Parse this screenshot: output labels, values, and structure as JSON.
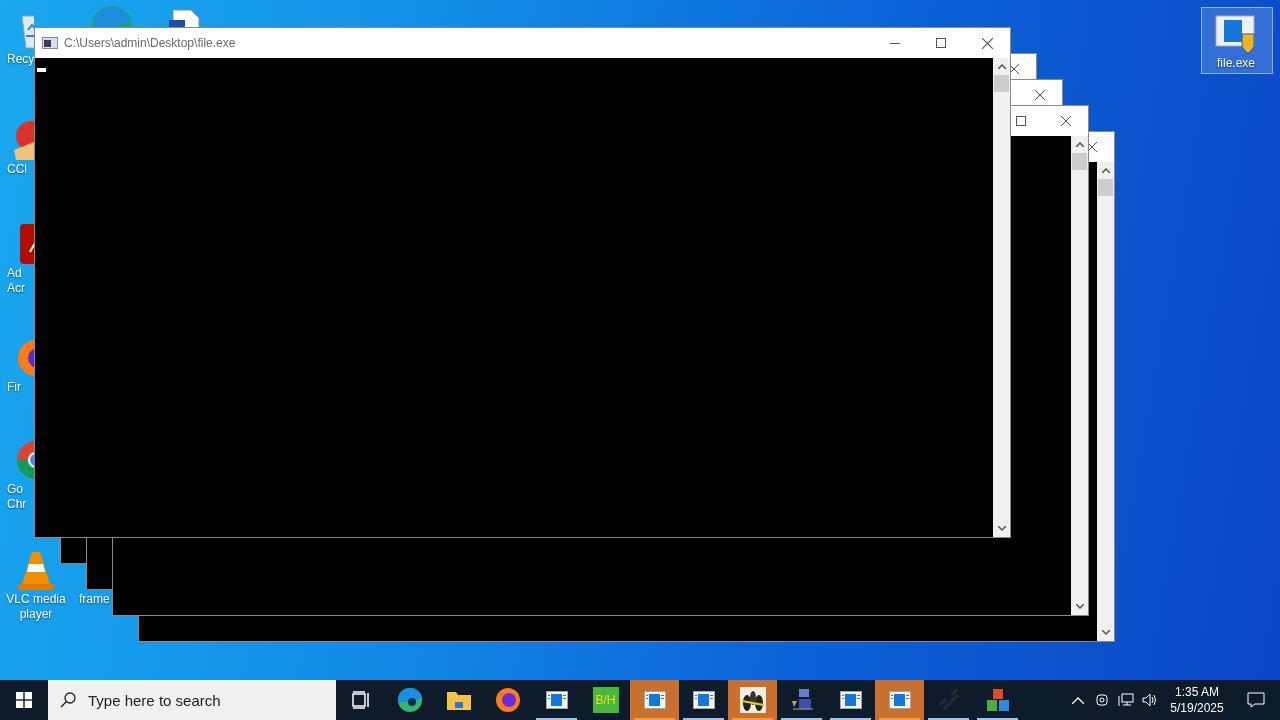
{
  "desktop_icons": [
    {
      "kind": "recycle-bin",
      "lines": [
        "Recy"
      ],
      "selected": false
    },
    {
      "kind": "edge",
      "selected": false
    },
    {
      "kind": "document",
      "selected": false
    },
    {
      "kind": "ccleaner",
      "lines": [
        "CCl"
      ],
      "selected": false
    },
    {
      "kind": "acrobat",
      "lines": [
        "Ad",
        "Acr"
      ],
      "selected": false
    },
    {
      "kind": "firefox",
      "lines": [
        "Fir"
      ],
      "selected": false
    },
    {
      "kind": "chrome",
      "lines": [
        "Go",
        "Chr"
      ],
      "selected": false
    },
    {
      "kind": "vlc",
      "lines": [
        "VLC media",
        "player"
      ],
      "selected": false
    },
    {
      "kind": "frame",
      "lines": [
        "frame"
      ],
      "selected": false
    },
    {
      "kind": "exe",
      "lines": [
        "file.exe"
      ],
      "selected": true
    }
  ],
  "windows": [
    {
      "kind": "console",
      "title": "C:\\Users\\admin\\Desktop\\file.exe",
      "cursor": true
    },
    {
      "kind": "console"
    },
    {
      "kind": "console"
    },
    {
      "kind": "console"
    },
    {
      "kind": "console"
    }
  ],
  "taskbar": {
    "search": {
      "placeholder": "Type here to search"
    },
    "items": [
      {
        "kind": "task-view",
        "running": false,
        "flashing": false
      },
      {
        "kind": "edge",
        "running": false,
        "flashing": false
      },
      {
        "kind": "folder",
        "running": false,
        "flashing": false
      },
      {
        "kind": "firefox",
        "running": false,
        "flashing": false
      },
      {
        "kind": "app-window",
        "running": true,
        "flashing": false
      },
      {
        "kind": "bh",
        "text": "B/H",
        "running": false,
        "flashing": false
      },
      {
        "kind": "app-window",
        "running": true,
        "flashing": true
      },
      {
        "kind": "app-window",
        "running": true,
        "flashing": false
      },
      {
        "kind": "binoculars",
        "running": true,
        "flashing": true
      },
      {
        "kind": "installer",
        "running": true,
        "flashing": false
      },
      {
        "kind": "app-window",
        "running": true,
        "flashing": false
      },
      {
        "kind": "app-window",
        "running": true,
        "flashing": true
      },
      {
        "kind": "link",
        "running": true,
        "flashing": false
      },
      {
        "kind": "cubes",
        "running": true,
        "flashing": false
      }
    ],
    "tray": {
      "time": "1:35 AM",
      "date": "5/19/2025"
    }
  }
}
